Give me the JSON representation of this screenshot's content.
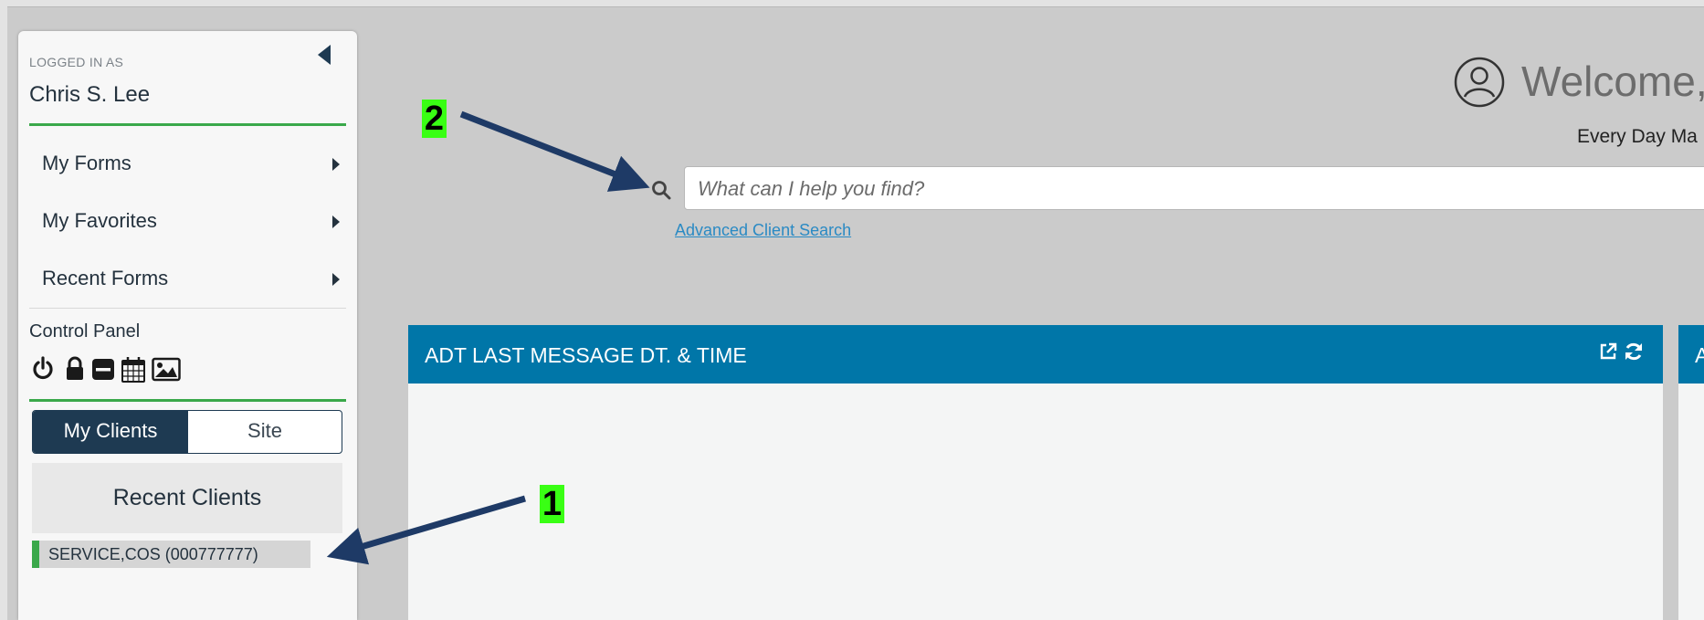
{
  "sidebar": {
    "logged_in_label": "LOGGED IN AS",
    "user_name": "Chris S. Lee",
    "menu": [
      {
        "label": "My Forms"
      },
      {
        "label": "My Favorites"
      },
      {
        "label": "Recent Forms"
      }
    ],
    "control_panel_label": "Control Panel",
    "control_icons": [
      "power-icon",
      "lock-icon",
      "minus-icon",
      "calendar-icon",
      "image-icon"
    ],
    "toggle": {
      "active": "My Clients",
      "inactive": "Site"
    },
    "recent_clients_title": "Recent Clients",
    "recent_clients": [
      {
        "label": "SERVICE,COS (000777777)"
      }
    ]
  },
  "header": {
    "welcome_text": "Welcome, C",
    "tagline": "Every Day Ma"
  },
  "search": {
    "placeholder": "What can I help you find?",
    "value": "",
    "advanced_link": "Advanced Client Search"
  },
  "widgets": [
    {
      "title": "ADT LAST MESSAGE DT. & TIME",
      "icons": [
        "external-link-icon",
        "refresh-icon"
      ]
    },
    {
      "title": "A"
    }
  ],
  "annotations": {
    "callout_1": "1",
    "callout_2": "2"
  },
  "colors": {
    "background": "#cbcbcb",
    "accent_green": "#3aa84a",
    "widget_header": "#0076a8",
    "toggle_active": "#1e3a52",
    "link": "#2a8ac4",
    "callout_bg": "#39ff14",
    "arrow": "#1e3a66"
  }
}
